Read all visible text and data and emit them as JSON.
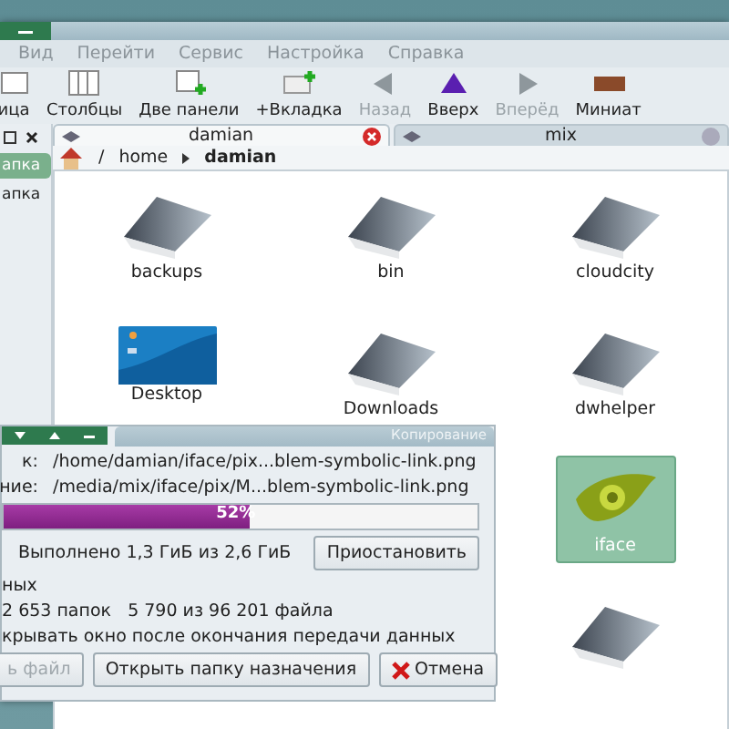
{
  "file_manager": {
    "menu": [
      "Вид",
      "Перейти",
      "Сервис",
      "Настройка",
      "Справка"
    ],
    "toolbar": [
      {
        "kind": "view",
        "label": "ица",
        "disabled": false
      },
      {
        "kind": "columns",
        "label": "Столбцы",
        "disabled": false
      },
      {
        "kind": "split",
        "label": "Две панели",
        "disabled": false
      },
      {
        "kind": "tab",
        "label": "+Вкладка",
        "disabled": false
      },
      {
        "kind": "back",
        "label": "Назад",
        "disabled": true
      },
      {
        "kind": "up",
        "label": "Вверх",
        "disabled": false
      },
      {
        "kind": "forward",
        "label": "Вперёд",
        "disabled": true
      },
      {
        "kind": "thumbs",
        "label": "Миниат",
        "disabled": false
      }
    ],
    "sidebar": [
      {
        "label": "апка",
        "selected": true
      },
      {
        "label": "апка",
        "selected": false
      }
    ],
    "tabs": [
      {
        "label": "damian",
        "selected": true
      },
      {
        "label": "mix",
        "selected": false
      }
    ],
    "breadcrumb": [
      "/",
      "home",
      "damian"
    ],
    "items": [
      {
        "kind": "folder",
        "label": "backups",
        "selected": false
      },
      {
        "kind": "folder",
        "label": "bin",
        "selected": false
      },
      {
        "kind": "folder",
        "label": "cloudcity",
        "selected": false
      },
      {
        "kind": "desktop",
        "label": "Desktop",
        "selected": false
      },
      {
        "kind": "folder",
        "label": "Downloads",
        "selected": false
      },
      {
        "kind": "folder",
        "label": "dwhelper",
        "selected": false
      },
      {
        "kind": "image",
        "label": "iface",
        "selected": true
      },
      {
        "kind": "folder",
        "selected": false
      }
    ]
  },
  "copy_dialog": {
    "title": "Копирование",
    "source_label": "к:",
    "source": "/home/damian/iface/pix...blem-symbolic-link.png",
    "dest_label": "ние:",
    "dest": "/media/mix/iface/pix/M...blem-symbolic-link.png",
    "progress": {
      "level": 0.52,
      "text": "52%"
    },
    "done": "Выполнено 1,3 ГиБ из 2,6 ГиБ",
    "pause_button": "Приостановить",
    "section": "ных",
    "counts": "2 653 папок   5 790 из 96 201 файла",
    "option": "крывать окно после окончания передачи данных",
    "buttons": [
      {
        "kind": "plain",
        "label": "ь файл",
        "disabled": true
      },
      {
        "kind": "plain",
        "label": "Открыть папку назначения",
        "disabled": false
      },
      {
        "kind": "cancel",
        "label": "Отмена",
        "disabled": false
      }
    ]
  }
}
